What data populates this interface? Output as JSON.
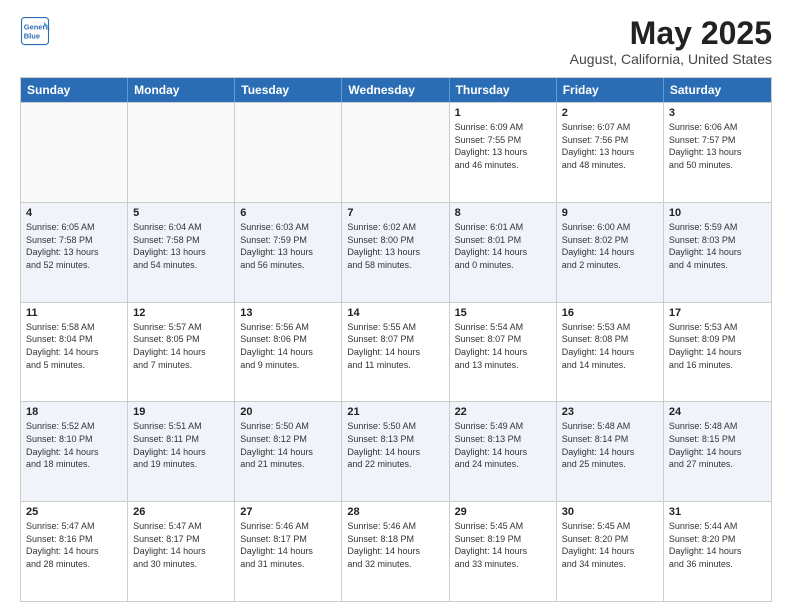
{
  "header": {
    "logo_line1": "General",
    "logo_line2": "Blue",
    "month": "May 2025",
    "location": "August, California, United States"
  },
  "weekdays": [
    "Sunday",
    "Monday",
    "Tuesday",
    "Wednesday",
    "Thursday",
    "Friday",
    "Saturday"
  ],
  "rows": [
    [
      {
        "day": "",
        "info": ""
      },
      {
        "day": "",
        "info": ""
      },
      {
        "day": "",
        "info": ""
      },
      {
        "day": "",
        "info": ""
      },
      {
        "day": "1",
        "info": "Sunrise: 6:09 AM\nSunset: 7:55 PM\nDaylight: 13 hours\nand 46 minutes."
      },
      {
        "day": "2",
        "info": "Sunrise: 6:07 AM\nSunset: 7:56 PM\nDaylight: 13 hours\nand 48 minutes."
      },
      {
        "day": "3",
        "info": "Sunrise: 6:06 AM\nSunset: 7:57 PM\nDaylight: 13 hours\nand 50 minutes."
      }
    ],
    [
      {
        "day": "4",
        "info": "Sunrise: 6:05 AM\nSunset: 7:58 PM\nDaylight: 13 hours\nand 52 minutes."
      },
      {
        "day": "5",
        "info": "Sunrise: 6:04 AM\nSunset: 7:58 PM\nDaylight: 13 hours\nand 54 minutes."
      },
      {
        "day": "6",
        "info": "Sunrise: 6:03 AM\nSunset: 7:59 PM\nDaylight: 13 hours\nand 56 minutes."
      },
      {
        "day": "7",
        "info": "Sunrise: 6:02 AM\nSunset: 8:00 PM\nDaylight: 13 hours\nand 58 minutes."
      },
      {
        "day": "8",
        "info": "Sunrise: 6:01 AM\nSunset: 8:01 PM\nDaylight: 14 hours\nand 0 minutes."
      },
      {
        "day": "9",
        "info": "Sunrise: 6:00 AM\nSunset: 8:02 PM\nDaylight: 14 hours\nand 2 minutes."
      },
      {
        "day": "10",
        "info": "Sunrise: 5:59 AM\nSunset: 8:03 PM\nDaylight: 14 hours\nand 4 minutes."
      }
    ],
    [
      {
        "day": "11",
        "info": "Sunrise: 5:58 AM\nSunset: 8:04 PM\nDaylight: 14 hours\nand 5 minutes."
      },
      {
        "day": "12",
        "info": "Sunrise: 5:57 AM\nSunset: 8:05 PM\nDaylight: 14 hours\nand 7 minutes."
      },
      {
        "day": "13",
        "info": "Sunrise: 5:56 AM\nSunset: 8:06 PM\nDaylight: 14 hours\nand 9 minutes."
      },
      {
        "day": "14",
        "info": "Sunrise: 5:55 AM\nSunset: 8:07 PM\nDaylight: 14 hours\nand 11 minutes."
      },
      {
        "day": "15",
        "info": "Sunrise: 5:54 AM\nSunset: 8:07 PM\nDaylight: 14 hours\nand 13 minutes."
      },
      {
        "day": "16",
        "info": "Sunrise: 5:53 AM\nSunset: 8:08 PM\nDaylight: 14 hours\nand 14 minutes."
      },
      {
        "day": "17",
        "info": "Sunrise: 5:53 AM\nSunset: 8:09 PM\nDaylight: 14 hours\nand 16 minutes."
      }
    ],
    [
      {
        "day": "18",
        "info": "Sunrise: 5:52 AM\nSunset: 8:10 PM\nDaylight: 14 hours\nand 18 minutes."
      },
      {
        "day": "19",
        "info": "Sunrise: 5:51 AM\nSunset: 8:11 PM\nDaylight: 14 hours\nand 19 minutes."
      },
      {
        "day": "20",
        "info": "Sunrise: 5:50 AM\nSunset: 8:12 PM\nDaylight: 14 hours\nand 21 minutes."
      },
      {
        "day": "21",
        "info": "Sunrise: 5:50 AM\nSunset: 8:13 PM\nDaylight: 14 hours\nand 22 minutes."
      },
      {
        "day": "22",
        "info": "Sunrise: 5:49 AM\nSunset: 8:13 PM\nDaylight: 14 hours\nand 24 minutes."
      },
      {
        "day": "23",
        "info": "Sunrise: 5:48 AM\nSunset: 8:14 PM\nDaylight: 14 hours\nand 25 minutes."
      },
      {
        "day": "24",
        "info": "Sunrise: 5:48 AM\nSunset: 8:15 PM\nDaylight: 14 hours\nand 27 minutes."
      }
    ],
    [
      {
        "day": "25",
        "info": "Sunrise: 5:47 AM\nSunset: 8:16 PM\nDaylight: 14 hours\nand 28 minutes."
      },
      {
        "day": "26",
        "info": "Sunrise: 5:47 AM\nSunset: 8:17 PM\nDaylight: 14 hours\nand 30 minutes."
      },
      {
        "day": "27",
        "info": "Sunrise: 5:46 AM\nSunset: 8:17 PM\nDaylight: 14 hours\nand 31 minutes."
      },
      {
        "day": "28",
        "info": "Sunrise: 5:46 AM\nSunset: 8:18 PM\nDaylight: 14 hours\nand 32 minutes."
      },
      {
        "day": "29",
        "info": "Sunrise: 5:45 AM\nSunset: 8:19 PM\nDaylight: 14 hours\nand 33 minutes."
      },
      {
        "day": "30",
        "info": "Sunrise: 5:45 AM\nSunset: 8:20 PM\nDaylight: 14 hours\nand 34 minutes."
      },
      {
        "day": "31",
        "info": "Sunrise: 5:44 AM\nSunset: 8:20 PM\nDaylight: 14 hours\nand 36 minutes."
      }
    ]
  ]
}
